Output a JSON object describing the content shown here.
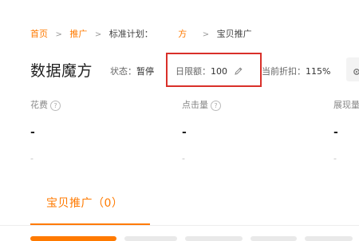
{
  "breadcrumb": {
    "home": "首页",
    "promotion": "推广",
    "plan_label": "标准计划：",
    "plan_name": "方",
    "current": "宝贝推广",
    "sep": ">"
  },
  "header": {
    "title": "数据魔方",
    "status_label": "状态：",
    "status_value": "暂停",
    "budget_label": "日限额：",
    "budget_value": "100",
    "discount_label": "当前折扣：",
    "discount_value": "115%"
  },
  "metrics": [
    {
      "label": "花费",
      "value": "-",
      "sub": "-"
    },
    {
      "label": "点击量",
      "value": "-",
      "sub": "-"
    },
    {
      "label": "展现量",
      "value": "-",
      "sub": "-"
    }
  ],
  "tabs": [
    {
      "label": "宝贝推广（0）",
      "active": true
    }
  ],
  "colors": {
    "accent": "#ff7a00",
    "highlight_box": "#d9302a"
  },
  "icons": {
    "edit": "pencil-icon",
    "help": "help-circle-icon",
    "settings": "gear-icon"
  }
}
